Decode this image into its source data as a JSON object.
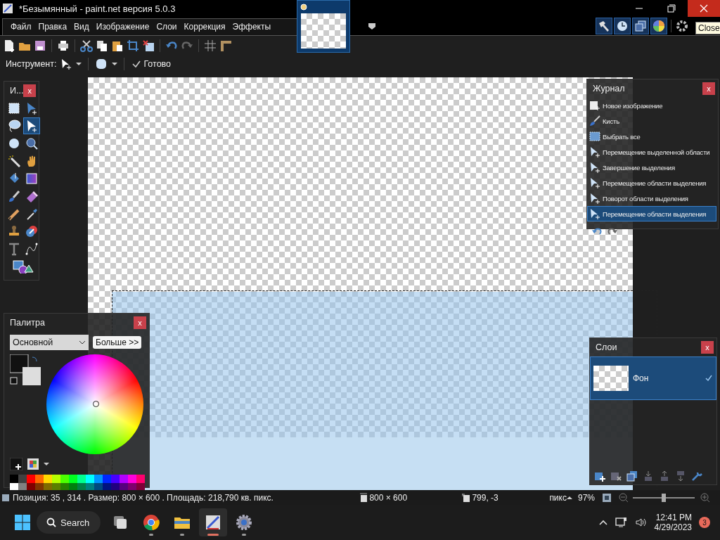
{
  "window": {
    "title": "*Безымянный - paint.net версия 5.0.3",
    "tooltip": "Close"
  },
  "menu": [
    "Файл",
    "Правка",
    "Вид",
    "Изображение",
    "Слои",
    "Коррекция",
    "Эффекты"
  ],
  "panel_toggles": [
    {
      "on": true
    },
    {
      "on": true
    },
    {
      "on": true
    },
    {
      "on": true
    }
  ],
  "tool_options": {
    "tool_label": "Инструмент:",
    "done": "Готово"
  },
  "tools_panel": {
    "title": "И...",
    "close": "x",
    "tools": [
      {
        "selected": false
      },
      {
        "selected": false
      },
      {
        "selected": false
      },
      {
        "selected": true
      },
      {
        "selected": false
      },
      {
        "selected": false
      },
      {
        "selected": false
      },
      {
        "selected": false
      },
      {
        "selected": false
      },
      {
        "selected": false
      },
      {
        "selected": false
      },
      {
        "selected": false
      },
      {
        "selected": false
      },
      {
        "selected": false
      },
      {
        "selected": false
      },
      {
        "selected": false
      },
      {
        "selected": false
      },
      {
        "selected": false
      },
      {
        "selected": false
      }
    ]
  },
  "history": {
    "title": "Журнал",
    "close": "x",
    "items": [
      {
        "kind": "new-image",
        "label": "Новое изображение",
        "selected": false
      },
      {
        "kind": "brush",
        "label": "Кисть",
        "selected": false
      },
      {
        "kind": "select-all",
        "label": "Выбрать все",
        "selected": false
      },
      {
        "kind": "move",
        "label": "Перемещение выделенной области",
        "selected": false
      },
      {
        "kind": "move",
        "label": "Завершение выделения",
        "selected": false
      },
      {
        "kind": "move",
        "label": "Перемещение области выделения",
        "selected": false
      },
      {
        "kind": "move",
        "label": "Поворот области выделения",
        "selected": false
      },
      {
        "kind": "move",
        "label": "Перемещение области выделения",
        "selected": true
      }
    ]
  },
  "palette": {
    "title": "Палитра",
    "close": "x",
    "mode": "Основной",
    "more": "Больше >>",
    "swatches": [
      {
        "color": "#000000"
      },
      {
        "color": "#404040"
      },
      {
        "color": "#ff0000"
      },
      {
        "color": "#ff6a00"
      },
      {
        "color": "#ffd800"
      },
      {
        "color": "#b6ff00"
      },
      {
        "color": "#4cff00"
      },
      {
        "color": "#00ff21"
      },
      {
        "color": "#00ff90"
      },
      {
        "color": "#00ffff"
      },
      {
        "color": "#0094ff"
      },
      {
        "color": "#0026ff"
      },
      {
        "color": "#4800ff"
      },
      {
        "color": "#b200ff"
      },
      {
        "color": "#ff00dc"
      },
      {
        "color": "#ff006e"
      },
      {
        "color": "#ffffff"
      },
      {
        "color": "#808080"
      },
      {
        "color": "#7f0000"
      },
      {
        "color": "#7f3300"
      },
      {
        "color": "#7f6a00"
      },
      {
        "color": "#5b7f00"
      },
      {
        "color": "#267f00"
      },
      {
        "color": "#007f0e"
      },
      {
        "color": "#007f46"
      },
      {
        "color": "#007f7f"
      },
      {
        "color": "#004a7f"
      },
      {
        "color": "#00137f"
      },
      {
        "color": "#21007f"
      },
      {
        "color": "#57007f"
      },
      {
        "color": "#7f006e"
      },
      {
        "color": "#7f0037"
      }
    ]
  },
  "layers": {
    "title": "Слои",
    "close": "x",
    "items": [
      {
        "name": "Фон",
        "selected": true,
        "visible": true
      }
    ]
  },
  "status_bar": {
    "position": "Позиция: 35 , 314 . Размер: 800  × 600 . Площадь: 218,790 кв. пикс.",
    "image_size": "800 × 600",
    "cursor": "799, -3",
    "units": "пикс",
    "zoom": "97%",
    "zoom_slider": {
      "level": 0.5
    }
  },
  "taskbar": {
    "search": "Search",
    "apps": [
      {
        "selected": false
      },
      {
        "selected": false
      },
      {
        "selected": false
      },
      {
        "selected": true
      },
      {
        "selected": false
      }
    ],
    "time": "12:41 PM",
    "date": "4/29/2023",
    "badge": "3"
  }
}
